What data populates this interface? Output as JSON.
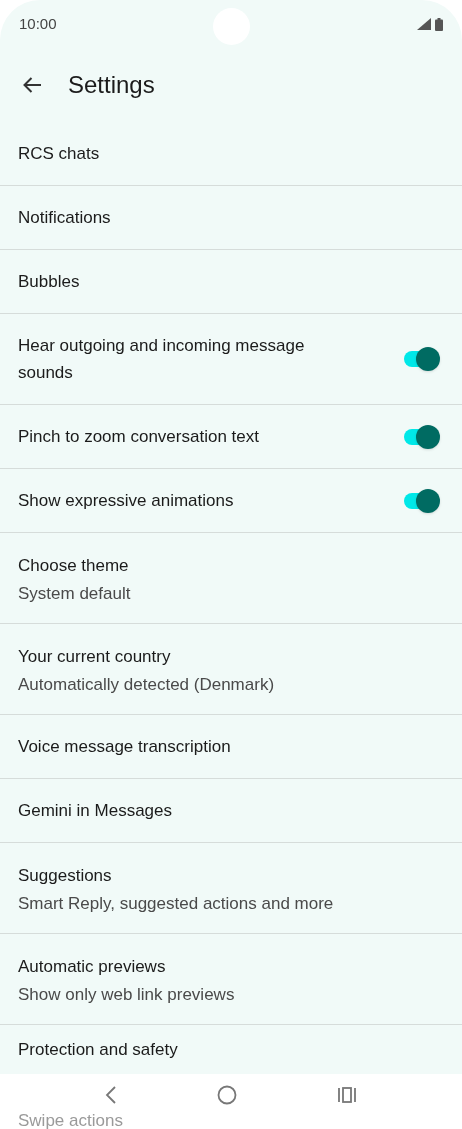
{
  "status_bar": {
    "time": "10:00"
  },
  "app_bar": {
    "title": "Settings"
  },
  "settings": [
    {
      "kind": "link",
      "title": "RCS chats"
    },
    {
      "kind": "link",
      "title": "Notifications"
    },
    {
      "kind": "link",
      "title": "Bubbles"
    },
    {
      "kind": "toggle",
      "title": "Hear outgoing and incoming message sounds",
      "on": true
    },
    {
      "kind": "toggle",
      "title": "Pinch to zoom conversation text",
      "on": true
    },
    {
      "kind": "toggle",
      "title": "Show expressive animations",
      "on": true
    },
    {
      "kind": "link",
      "title": "Choose theme",
      "subtitle": "System default"
    },
    {
      "kind": "link",
      "title": "Your current country",
      "subtitle": "Automatically detected (Denmark)"
    },
    {
      "kind": "link",
      "title": "Voice message transcription"
    },
    {
      "kind": "link",
      "title": "Gemini in Messages"
    },
    {
      "kind": "link",
      "title": "Suggestions",
      "subtitle": "Smart Reply, suggested actions and more"
    },
    {
      "kind": "link",
      "title": "Automatic previews",
      "subtitle": "Show only web link previews"
    },
    {
      "kind": "link",
      "title": "Protection and safety"
    }
  ],
  "partially_hidden_item": "Swipe actions"
}
